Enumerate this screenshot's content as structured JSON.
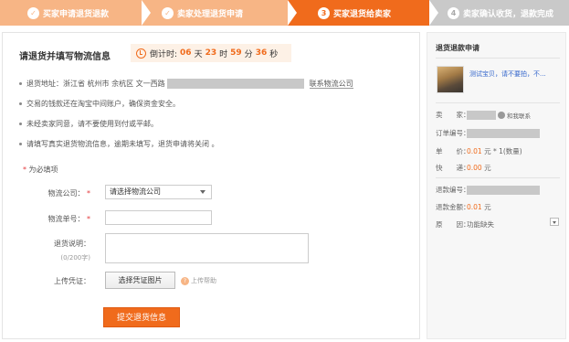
{
  "steps": [
    {
      "num": "✓",
      "label": "买家申请退货退款",
      "state": "done"
    },
    {
      "num": "✓",
      "label": "卖家处理退货申请",
      "state": "done"
    },
    {
      "num": "3",
      "label": "买家退货给卖家",
      "state": "current"
    },
    {
      "num": "4",
      "label": "卖家确认收货，退款完成",
      "state": "todo"
    }
  ],
  "main": {
    "title": "请退货并填写物流信息",
    "countdown": {
      "label": "倒计时:",
      "days": "06",
      "days_unit": "天",
      "hours": "23",
      "hours_unit": "时",
      "minutes": "59",
      "minutes_unit": "分",
      "seconds": "36",
      "seconds_unit": "秒"
    },
    "address_label": "退货地址：浙江省 杭州市 余杭区 文一西路",
    "contact_link": "联系物流公司",
    "notes": [
      "交易的钱款还在淘宝中间账户，确保资金安全。",
      "未经卖家同意，请不要使用到付或平邮。",
      "请填写真实退货物流信息，逾期未填写，退货申请将关闭 。"
    ],
    "required_note": "为必填项",
    "required_star": "*",
    "form": {
      "company_label": "物流公司：",
      "company_value": "请选择物流公司",
      "tracking_label": "物流单号：",
      "remark_label": "退货说明：",
      "remark_counter": "(0/200字)",
      "upload_label": "上传凭证：",
      "upload_button": "选择凭证图片",
      "help_text": "上传帮助",
      "submit_button": "提交退货信息"
    }
  },
  "sidebar": {
    "title": "退货退款申请",
    "product_link": "测试宝贝，请不要拍，不...",
    "seller_key": "卖　　家：",
    "seller_badge": "和我联系",
    "order_key": "订单编号：",
    "price_key": "单　　价：",
    "price_value": "0.01",
    "price_suffix": "元 * 1(数量)",
    "shipping_key": "快　　递：",
    "shipping_value": "0.00",
    "shipping_suffix": "元",
    "refund_no_key": "退款编号：",
    "refund_amount_key": "退款金额：",
    "refund_amount_value": "0.01",
    "refund_amount_suffix": "元",
    "reason_key": "原　　因：",
    "reason_value": "功能缺失"
  },
  "colors": {
    "accent": "#f06b1c",
    "done": "#f7b585",
    "todo": "#c9c9c9"
  }
}
